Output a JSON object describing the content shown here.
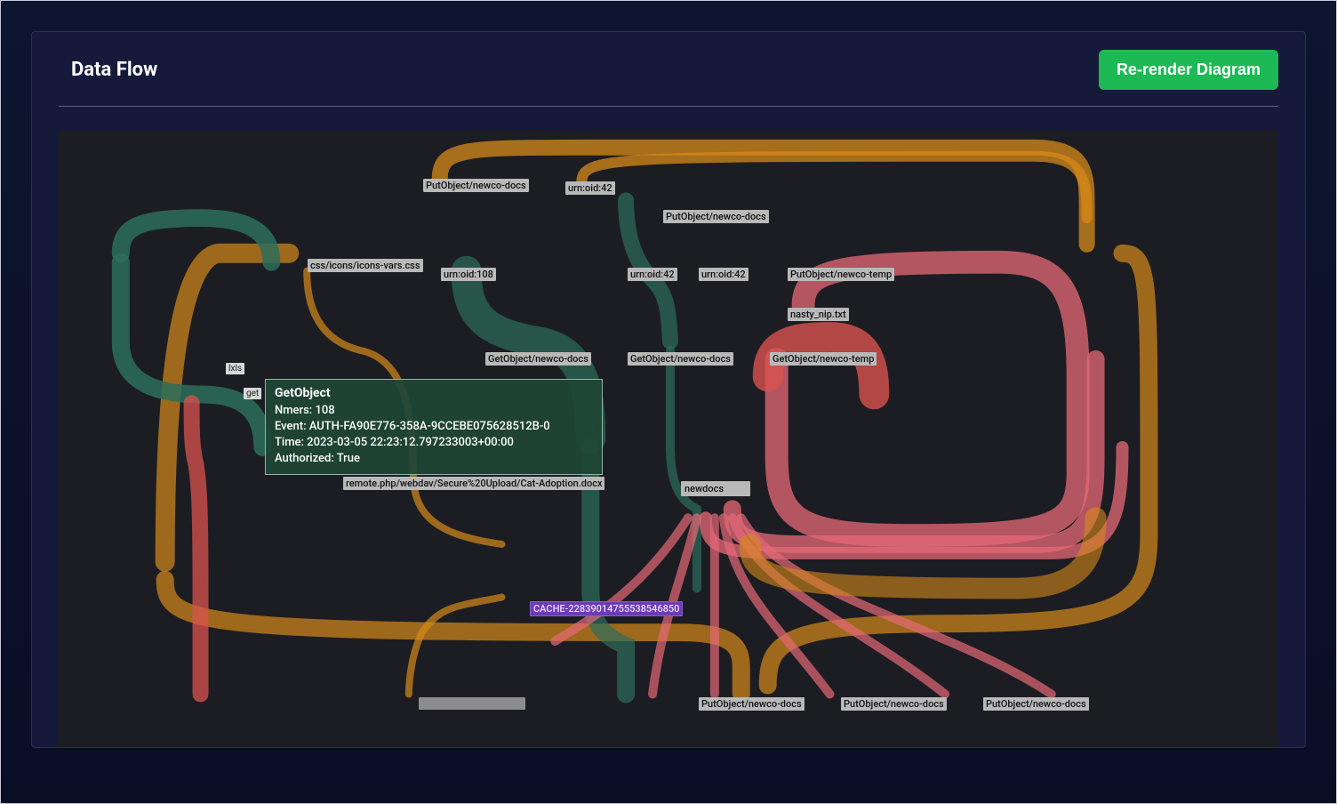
{
  "panel": {
    "title": "Data Flow",
    "rerender_label": "Re-render Diagram"
  },
  "tooltip": {
    "title": "GetObject",
    "nmers_label": "Nmers: 108",
    "event_label": "Event: AUTH-FA90E776-358A-9CCEBE075628512B-0",
    "time_label": "Time: 2023-03-05 22:23:12.797233003+00:00",
    "authorized_label": "Authorized: True"
  },
  "nodes": {
    "css_icons": "css/icons/icons-vars.css",
    "putobject_newco_docs_top": "PutObject/newco-docs",
    "urn_oid_42_top": "urn:oid:42",
    "putobject_newco_docs_right": "PutObject/newco-docs",
    "urn_oid_108": "urn:oid:108",
    "urn_oid_42_mid1": "urn:oid:42",
    "urn_oid_42_mid2": "urn:oid:42",
    "putobject_newco_temp": "PutObject/newco-temp",
    "nasty_nip": "nasty_nip.txt",
    "getobject_newco_docs_1": "GetObject/newco-docs",
    "getobject_newco_docs_2": "GetObject/newco-docs",
    "getobject_newco_temp": "GetObject/newco-temp",
    "tag_left": "lxls",
    "tag_get": "get",
    "remote_php": "remote.php/webdav/Secure%20Upload/Cat-Adoption.docx",
    "newdocs": "newdocs",
    "cache": "CACHE-22839014755538546850",
    "putobject_newco_docs_b1": "PutObject/newco-docs",
    "putobject_newco_docs_b2": "PutObject/newco-docs",
    "putobject_newco_docs_b3": "PutObject/newco-docs"
  },
  "colors": {
    "orange": "#d68a1a",
    "teal": "#2c6e5a",
    "red": "#d9534f",
    "pink": "#e66a77",
    "purple": "#6b3db5"
  }
}
